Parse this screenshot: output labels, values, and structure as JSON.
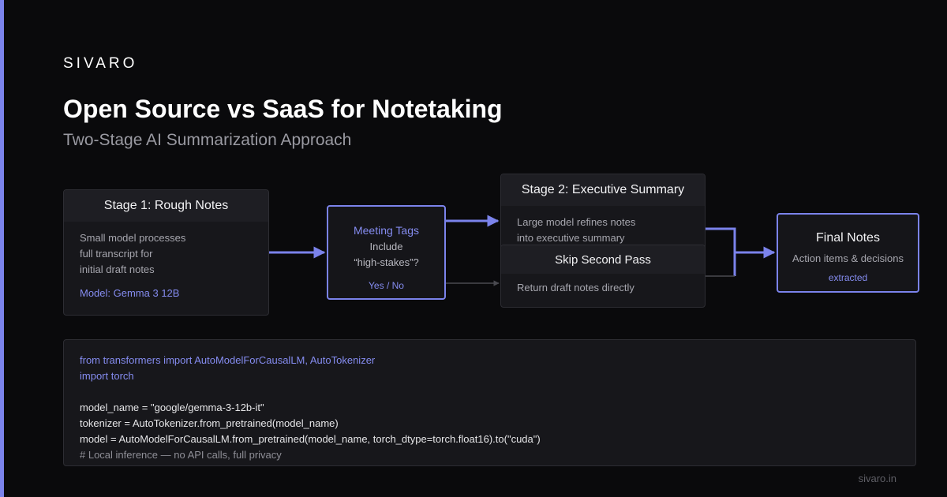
{
  "brand": "SIVARO",
  "title": "Open Source vs SaaS for Notetaking",
  "subtitle": "Two-Stage AI Summarization Approach",
  "diagram": {
    "stage1": {
      "title": "Stage 1: Rough Notes",
      "body": "Small model processes\nfull transcript for\ninitial draft notes",
      "model": "Model: Gemma 3 12B"
    },
    "tags": {
      "title": "Meeting Tags",
      "line1": "Include",
      "line2": "“high-stakes”?",
      "choice": "Yes / No"
    },
    "stage2": {
      "title": "Stage 2: Executive Summary",
      "body": "Large model refines notes\ninto executive summary"
    },
    "skip": {
      "title": "Skip Second Pass",
      "body": "Return draft notes directly"
    },
    "final": {
      "title": "Final Notes",
      "desc": "Action items & decisions",
      "extra": "extracted"
    }
  },
  "code": {
    "lines": [
      "from transformers import AutoModelForCausalLM, AutoTokenizer",
      "import torch",
      "",
      "model_name = \"google/gemma-3-12b-it\"",
      "tokenizer = AutoTokenizer.from_pretrained(model_name)",
      "model = AutoModelForCausalLM.from_pretrained(model_name, torch_dtype=torch.float16).to(\"cuda\")",
      "# Local inference — no API calls, full privacy"
    ]
  },
  "footer": "sivaro.in",
  "colors": {
    "accent": "#7b83eb",
    "background": "#0a0a0c",
    "card": "#17171b",
    "muted_connector": "#4a4a50"
  }
}
